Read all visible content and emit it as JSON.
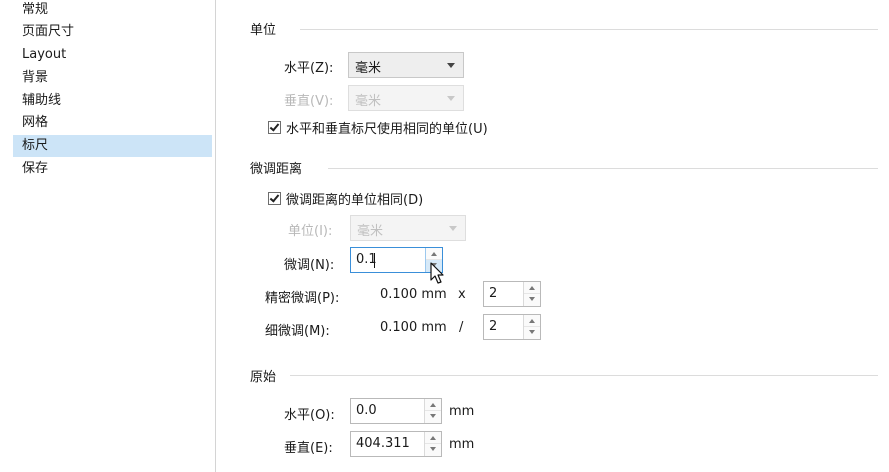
{
  "nav": {
    "items": [
      {
        "label": "常规"
      },
      {
        "label": "页面尺寸"
      },
      {
        "label": "Layout"
      },
      {
        "label": "背景"
      },
      {
        "label": "辅助线"
      },
      {
        "label": "网格"
      },
      {
        "label": "标尺"
      },
      {
        "label": "保存"
      }
    ],
    "selected": "标尺"
  },
  "units": {
    "title": "单位",
    "horizontal_label": "水平(Z):",
    "horizontal_value": "毫米",
    "vertical_label": "垂直(V):",
    "vertical_value": "毫米",
    "same_units_checkbox": "水平和垂直标尺使用相同的单位(U)",
    "same_units_checked": true
  },
  "nudge": {
    "title": "微调距离",
    "same_units_checkbox": "微调距离的单位相同(D)",
    "same_units_checked": true,
    "unit_label": "单位(I):",
    "unit_value": "毫米",
    "nudge_label": "微调(N):",
    "nudge_value": "0.1",
    "super_label": "精密微调(P):",
    "super_value": "0.100 mm",
    "super_op": "x",
    "super_factor": "2",
    "micro_label": "细微调(M):",
    "micro_value": "0.100 mm",
    "micro_op": "/",
    "micro_factor": "2"
  },
  "origin": {
    "title": "原始",
    "horizontal_label": "水平(O):",
    "horizontal_value": "0.0",
    "horizontal_unit": "mm",
    "vertical_label": "垂直(E):",
    "vertical_value": "404.311",
    "vertical_unit": "mm"
  }
}
